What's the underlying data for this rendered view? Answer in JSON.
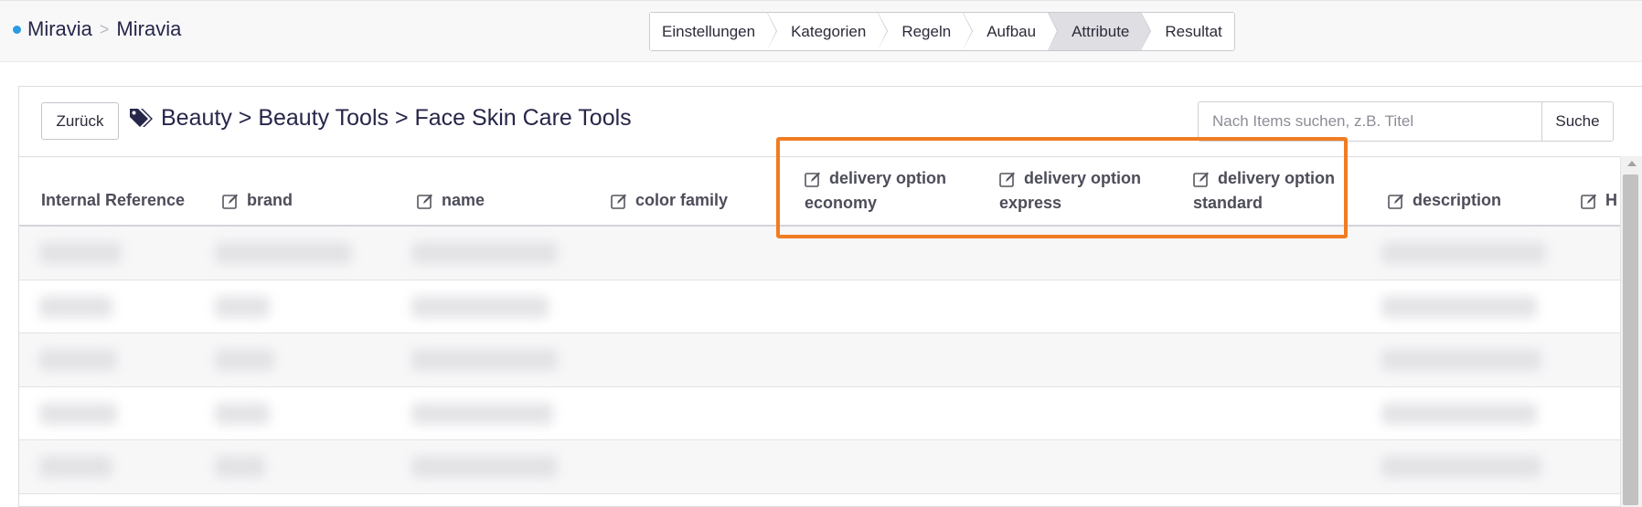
{
  "breadcrumb": {
    "first": "Miravia",
    "separator": ">",
    "second": "Miravia"
  },
  "steps": [
    "Einstellungen",
    "Kategorien",
    "Regeln",
    "Aufbau",
    "Attribute",
    "Resultat"
  ],
  "active_step": "Attribute",
  "panel": {
    "back_label": "Zurück",
    "category_path": "Beauty > Beauty Tools > Face Skin Care Tools",
    "search_placeholder": "Nach Items suchen, z.B. Titel",
    "search_button": "Suche"
  },
  "table": {
    "columns": [
      {
        "label_1": "Internal Reference",
        "label_2": "",
        "checkbox": false
      },
      {
        "label_1": "brand",
        "label_2": "",
        "checkbox": true
      },
      {
        "label_1": "name",
        "label_2": "",
        "checkbox": true
      },
      {
        "label_1": "color family",
        "label_2": "",
        "checkbox": true
      },
      {
        "label_1": "delivery option",
        "label_2": "economy",
        "checkbox": true
      },
      {
        "label_1": "delivery option",
        "label_2": "express",
        "checkbox": true
      },
      {
        "label_1": "delivery option",
        "label_2": "standard",
        "checkbox": true
      },
      {
        "label_1": "description",
        "label_2": "",
        "checkbox": true
      },
      {
        "label_1": "H",
        "label_2": "",
        "checkbox": true
      }
    ],
    "row_count": 5
  },
  "colors": {
    "accent_dot": "#2a9be0",
    "highlight_border": "#f07c22",
    "active_step_bg": "#dedee3"
  }
}
